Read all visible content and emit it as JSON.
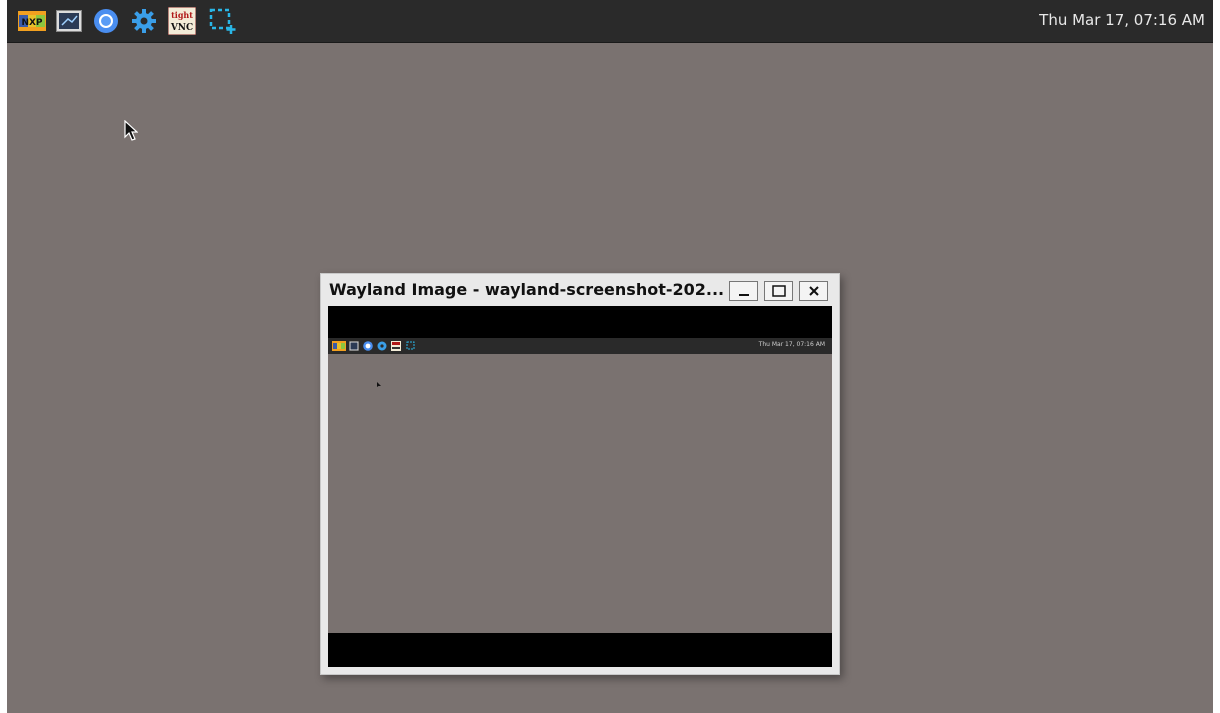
{
  "panel": {
    "launchers": [
      {
        "name": "nxp-logo-icon",
        "label": "NXP"
      },
      {
        "name": "terminal-icon"
      },
      {
        "name": "chromium-icon"
      },
      {
        "name": "settings-gear-icon"
      },
      {
        "name": "tightvnc-icon",
        "label": "tight VNC"
      },
      {
        "name": "screenshot-tool-icon"
      }
    ],
    "clock": "Thu Mar 17, 07:16 AM"
  },
  "window": {
    "title": "Wayland Image - wayland-screenshot-202...",
    "minimize_label": "_",
    "maximize_label": "☐",
    "close_label": "✕",
    "screenshot": {
      "clock": "Thu Mar 17, 07:16 AM"
    }
  },
  "colors": {
    "desktop": "#7a7270",
    "panel": "#2a2a2a",
    "window_frame": "#e9e9e9",
    "accent_cyan": "#29b6e6"
  }
}
